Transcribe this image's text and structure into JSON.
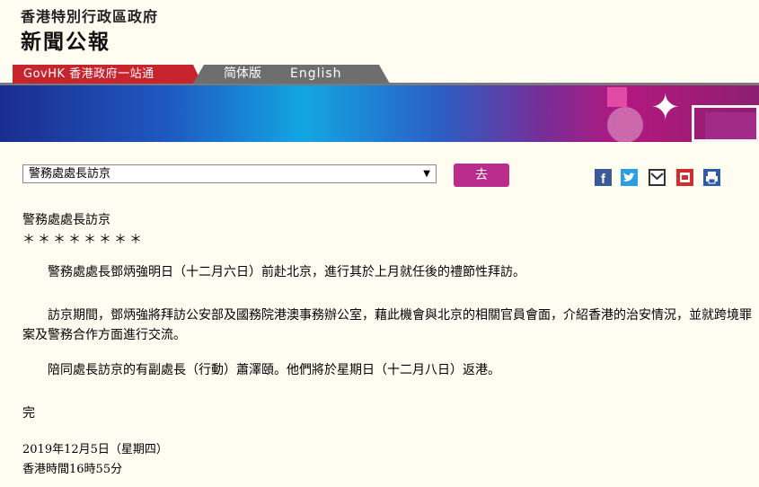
{
  "header": {
    "line1": "香港特別行政區政府",
    "line2": "新聞公報"
  },
  "nav": {
    "govhk": "GovHK 香港政府一站通",
    "simplified": "简体版",
    "english": "English"
  },
  "toolbar": {
    "topic_selected": "警務處處長訪京",
    "go_label": "去"
  },
  "share_icons": [
    "facebook-icon",
    "twitter-icon",
    "email-icon",
    "print-friendly-icon",
    "print-icon"
  ],
  "article": {
    "title": "警務處處長訪京",
    "stars": "＊＊＊＊＊＊＊＊",
    "paragraphs": [
      "警務處處長鄧炳強明日（十二月六日）前赴北京，進行其於上月就任後的禮節性拜訪。",
      "訪京期間，鄧炳強將拜訪公安部及國務院港澳事務辦公室，藉此機會與北京的相關官員會面，介紹香港的治安情況，並就跨境罪案及警務合作方面進行交流。",
      "陪同處長訪京的有副處長（行動）蕭澤頤。他們將於星期日（十二月八日）返港。"
    ],
    "end": "完",
    "date": "2019年12月5日（星期四）",
    "time": "香港時間16時55分"
  },
  "colors": {
    "background": "#fffdf2",
    "govhk_red": "#c8242d",
    "nav_grey": "#6e6e6e",
    "go_button": "#bb2d8c"
  }
}
